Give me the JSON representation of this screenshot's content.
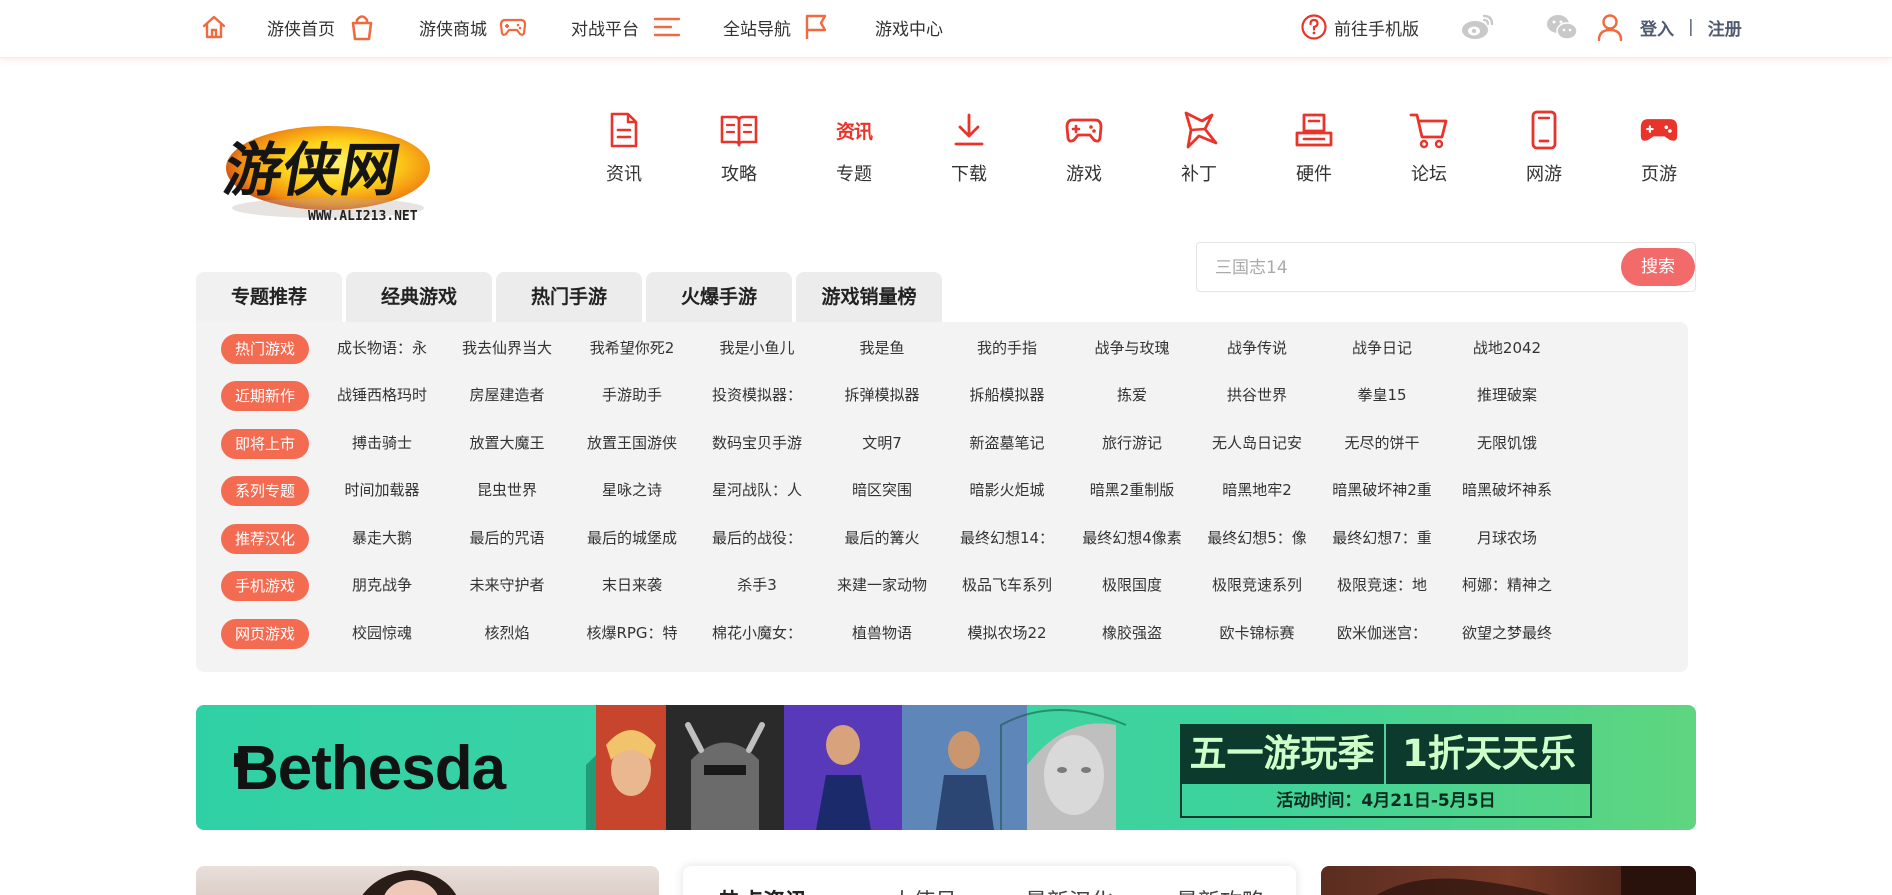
{
  "topbar": {
    "items": [
      {
        "label": "",
        "icon": "home-icon"
      },
      {
        "label": "游侠首页",
        "icon": "shopping-bag-icon"
      },
      {
        "label": "游侠商城",
        "icon": "gamepad-icon"
      },
      {
        "label": "对战平台",
        "icon": "menu-lines-icon"
      },
      {
        "label": "全站导航",
        "icon": "flag-icon"
      },
      {
        "label": "游戏中心",
        "icon": ""
      }
    ],
    "mobile_label": "前往手机版",
    "login_label": "登入",
    "separator": "|",
    "register_label": "注册"
  },
  "logo": {
    "text": "游侠网",
    "url_text": "WWW.ALI213.NET"
  },
  "nav": [
    {
      "label": "资讯",
      "icon": "document-icon"
    },
    {
      "label": "攻略",
      "icon": "book-icon"
    },
    {
      "label": "专题",
      "icon": "special-topic-icon",
      "icon_text": "资讯"
    },
    {
      "label": "下载",
      "icon": "download-icon"
    },
    {
      "label": "游戏",
      "icon": "gamepad-icon"
    },
    {
      "label": "补丁",
      "icon": "patch-icon"
    },
    {
      "label": "硬件",
      "icon": "hardware-icon"
    },
    {
      "label": "论坛",
      "icon": "cart-icon"
    },
    {
      "label": "网游",
      "icon": "phone-icon"
    },
    {
      "label": "页游",
      "icon": "controller-icon"
    }
  ],
  "search": {
    "placeholder": "三国志14",
    "button_label": "搜索"
  },
  "tabs": [
    "专题推荐",
    "经典游戏",
    "热门手游",
    "火爆手游",
    "游戏销量榜"
  ],
  "categories": [
    {
      "label": "热门游戏",
      "games": [
        "成长物语：永",
        "我去仙界当大",
        "我希望你死2",
        "我是小鱼儿",
        "我是鱼",
        "我的手指",
        "战争与玫瑰",
        "战争传说",
        "战争日记",
        "战地2042"
      ]
    },
    {
      "label": "近期新作",
      "games": [
        "战锤西格玛时",
        "房屋建造者",
        "手游助手",
        "投资模拟器：",
        "拆弹模拟器",
        "拆船模拟器",
        "拣爱",
        "拱谷世界",
        "拳皇15",
        "推理破案"
      ]
    },
    {
      "label": "即将上市",
      "games": [
        "搏击骑士",
        "放置大魔王",
        "放置王国游侠",
        "数码宝贝手游",
        "文明7",
        "新盗墓笔记",
        "旅行游记",
        "无人岛日记安",
        "无尽的饼干",
        "无限饥饿"
      ]
    },
    {
      "label": "系列专题",
      "games": [
        "时间加载器",
        "昆虫世界",
        "星咏之诗",
        "星河战队：人",
        "暗区突围",
        "暗影火炬城",
        "暗黑2重制版",
        "暗黑地牢2",
        "暗黑破坏神2重",
        "暗黑破坏神系"
      ]
    },
    {
      "label": "推荐汉化",
      "games": [
        "暴走大鹅",
        "最后的咒语",
        "最后的城堡成",
        "最后的战役：",
        "最后的篝火",
        "最终幻想14：",
        "最终幻想4像素",
        "最终幻想5：像",
        "最终幻想7：重",
        "月球农场"
      ]
    },
    {
      "label": "手机游戏",
      "games": [
        "朋克战争",
        "未来守护者",
        "末日来袭",
        "杀手3",
        "来建一家动物",
        "极品飞车系列",
        "极限国度",
        "极限竞速系列",
        "极限竞速：地",
        "柯娜：精神之"
      ]
    },
    {
      "label": "网页游戏",
      "games": [
        "校园惊魂",
        "核烈焰",
        "核爆RPG：特",
        "棉花小魔女：",
        "植兽物语",
        "模拟农场22",
        "橡胶强盗",
        "欧卡锦标赛",
        "欧米伽迷宫：",
        "欲望之梦最终"
      ]
    }
  ],
  "banner": {
    "brand": "Bethesda",
    "promo_title_a": "五一游玩季",
    "promo_title_b": "1折天天乐",
    "promo_date": "活动时间：4月21日-5月5日"
  },
  "bottom_tabs": [
    "热点资讯",
    "大使号",
    "最新汉化",
    "最新攻略"
  ],
  "colors": {
    "accent": "#f36c52",
    "search_button": "#f26a6a",
    "nav_icon": "#e8342a"
  }
}
